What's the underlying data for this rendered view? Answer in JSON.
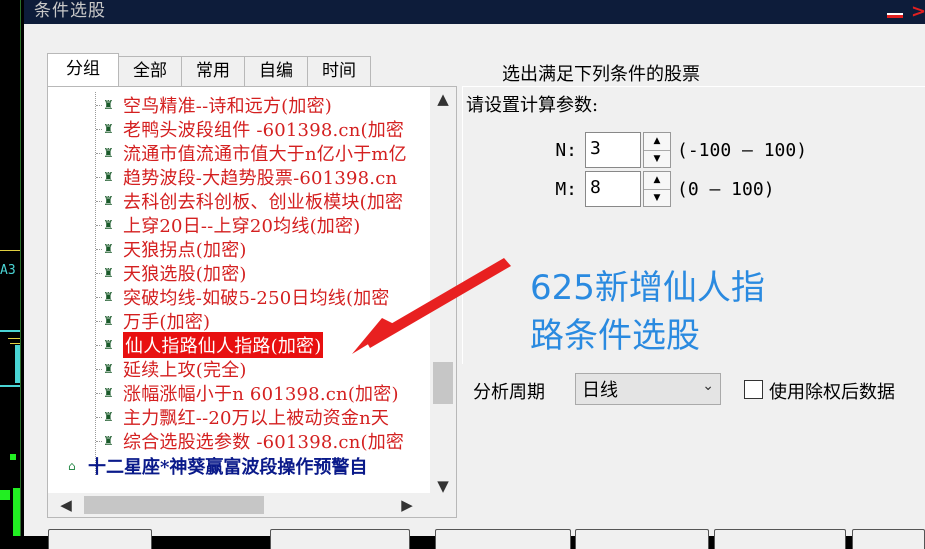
{
  "window": {
    "title": "条件选股"
  },
  "left_strip": {
    "label": "A3"
  },
  "tabs": [
    {
      "label": "分组"
    },
    {
      "label": "全部"
    },
    {
      "label": "常用"
    },
    {
      "label": "自编"
    },
    {
      "label": "时间"
    }
  ],
  "tree": {
    "items": [
      {
        "label": "空鸟精准--诗和远方(加密)"
      },
      {
        "label": "老鸭头波段组件 -601398.cn(加密"
      },
      {
        "label": "流通市值流通市值大于n亿小于m亿"
      },
      {
        "label": "趋势波段-大趋势股票-601398.cn"
      },
      {
        "label": "去科创去科创板、创业板模块(加密"
      },
      {
        "label": "上穿20日--上穿20均线(加密)"
      },
      {
        "label": "天狼拐点(加密)"
      },
      {
        "label": "天狼选股(加密)"
      },
      {
        "label": "突破均线-如破5-250日均线(加密"
      },
      {
        "label": "万手(加密)"
      },
      {
        "label": "仙人指路仙人指路(加密)",
        "selected": true
      },
      {
        "label": "延续上攻(完全)"
      },
      {
        "label": "涨幅涨幅小于n 601398.cn(加密)"
      },
      {
        "label": "主力飘红--20万以上被动资金n天"
      },
      {
        "label": "综合选股选参数 -601398.cn(加密"
      }
    ],
    "groups": [
      {
        "label": "十二星座*神葵赢富波段操作预警自"
      }
    ]
  },
  "header": {
    "text": "选出满足下列条件的股票"
  },
  "params": {
    "title": "请设置计算参数:",
    "rows": [
      {
        "label": "N:",
        "value": "3",
        "range": "(-100 — 100)"
      },
      {
        "label": "M:",
        "value": "8",
        "range": "(0 — 100)"
      }
    ]
  },
  "annotation": {
    "line1": "625新增仙人指",
    "line2": "路条件选股",
    "color": "#2a8ae0",
    "arrow_color": "#e82020"
  },
  "period": {
    "label": "分析周期",
    "selected": "日线"
  },
  "adjust": {
    "label": "使用除权后数据",
    "checked": false
  },
  "scroll_icons": {
    "up": "▲",
    "down": "▼",
    "left": "◀",
    "right": "▶"
  }
}
